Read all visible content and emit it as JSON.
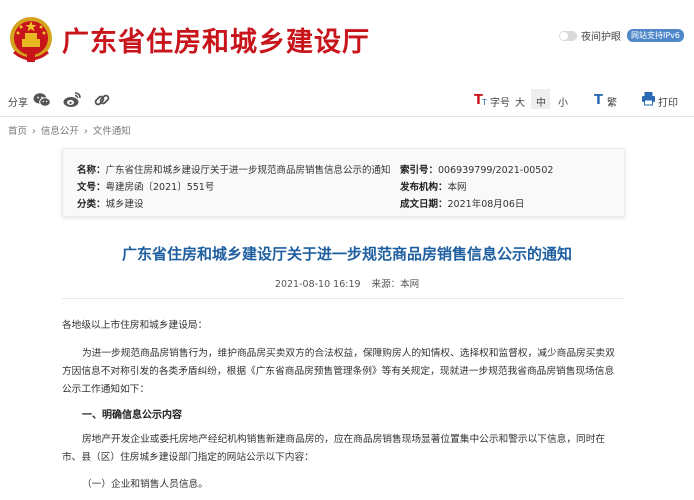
{
  "header": {
    "site_title": "广东省住房和城乡建设厅",
    "night_mode_label": "夜间护眼",
    "ipv6_badge": "网站支持IPv6"
  },
  "toolbar": {
    "share_label": "分享",
    "share_icons": [
      "wechat-icon",
      "weibo-icon",
      "link-icon"
    ],
    "font_size_label": "字号",
    "font_large": "大",
    "font_medium": "中",
    "font_small": "小",
    "traditional_label": "繁",
    "print_label": "打印"
  },
  "breadcrumb": {
    "home": "首页",
    "sep": "›",
    "level1": "信息公开",
    "level2": "文件通知"
  },
  "info": {
    "name_key": "名称：",
    "name_val": "广东省住房和城乡建设厅关于进一步规范商品房销售信息公示的通知",
    "doc_no_key": "文号：",
    "doc_no_val": "粤建房函〔2021〕551号",
    "category_key": "分类：",
    "category_val": "城乡建设",
    "index_key": "索引号：",
    "index_val": "006939799/2021-00502",
    "issuer_key": "发布机构：",
    "issuer_val": "本网",
    "date_key": "成文日期：",
    "date_val": "2021年08月06日"
  },
  "article": {
    "title": "广东省住房和城乡建设厅关于进一步规范商品房销售信息公示的通知",
    "date": "2021-08-10  16:19",
    "source": "来源：本网",
    "salutation": "各地级以上市住房和城乡建设局：",
    "para1_line1": "为进一步规范商品房销售行为，维护商品房买卖双方的合法权益，保障购房人的知情权、选择权和监督权，减少商品房买卖双",
    "para1_line2": "方因信息不对称引发的各类矛盾纠纷，根据《广东省商品房预售管理条例》等有关规定，现就进一步规范我省商品房销售现场信息",
    "para1_line3": "公示工作通知如下：",
    "heading1": "一、明确信息公示内容",
    "para2_line1": "房地产开发企业或委托房地产经纪机构销售新建商品房的，应在商品房销售现场显著位置集中公示和警示以下信息，同时在",
    "para2_line2": "市、县（区）住房城乡建设部门指定的网站公示以下内容：",
    "item1": "（一）企业和销售人员信息。"
  },
  "colors": {
    "brand_red": "#c8141b",
    "title_blue": "#1f5fa0",
    "badge_blue": "#4f87c9"
  }
}
